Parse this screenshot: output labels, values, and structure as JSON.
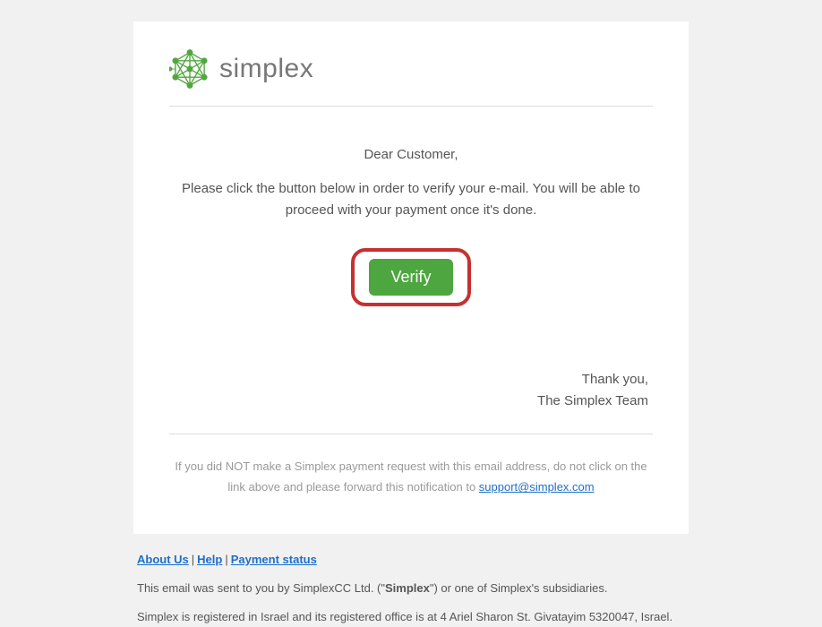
{
  "logo": {
    "text": "simplex"
  },
  "body": {
    "greeting": "Dear Customer,",
    "instruction": "Please click the button below in order to verify your e-mail. You will be able to proceed with your payment once it's done.",
    "verify_label": "Verify",
    "thanks_line1": "Thank you,",
    "thanks_line2": "The Simplex Team",
    "notice_before": "If you did NOT make a Simplex payment request with this email address, do not click on the link above and please forward this notification to ",
    "notice_link": "support@simplex.com"
  },
  "footer": {
    "links": {
      "about": "About Us",
      "help": "Help",
      "payment_status": "Payment status"
    },
    "sent_by_before": "This email was sent to you by SimplexCC Ltd. (\"",
    "sent_by_strong": "Simplex",
    "sent_by_after": "\") or one of Simplex's subsidiaries.",
    "registered": "Simplex is registered in Israel and its registered office is at 4 Ariel Sharon St. Givatayim 5320047, Israel."
  }
}
